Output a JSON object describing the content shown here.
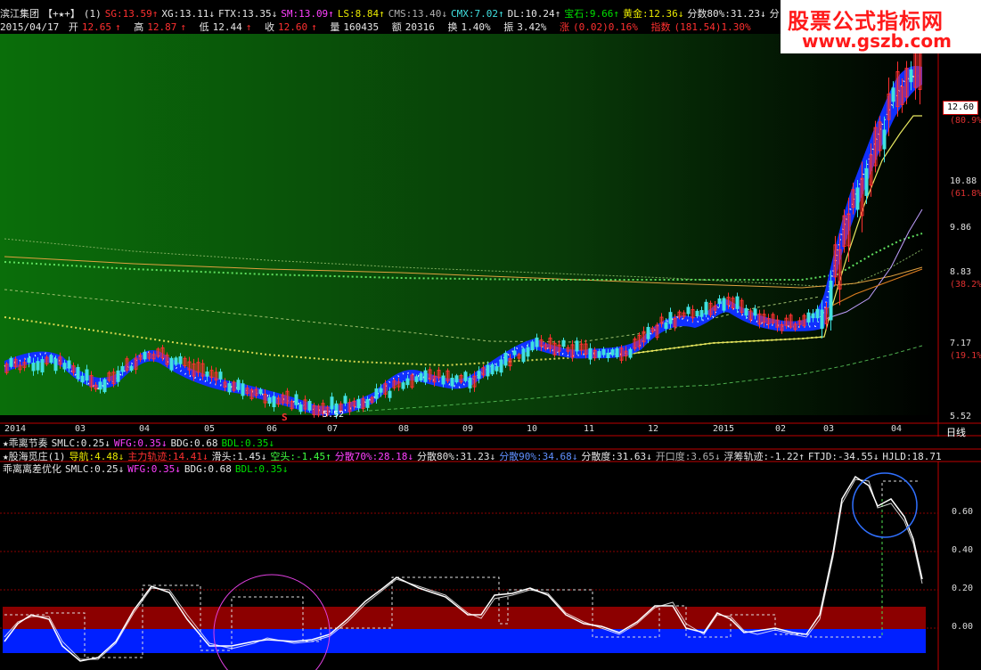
{
  "header": {
    "stock_name": "滨江集团",
    "stars": "【+★+】",
    "count": "(1)",
    "indicators": [
      {
        "label": "SG:13.59",
        "arrow": "↑",
        "color": "red"
      },
      {
        "label": "XG:13.11",
        "arrow": "↓",
        "color": "white"
      },
      {
        "label": "FTX:13.35",
        "arrow": "↓",
        "color": "white"
      },
      {
        "label": "SM:13.09",
        "arrow": "↑",
        "color": "magenta"
      },
      {
        "label": "LS:8.84",
        "arrow": "↑",
        "color": "yellow"
      },
      {
        "label": "CMS:13.40",
        "arrow": "↓",
        "color": "gray"
      },
      {
        "label": "CMX:7.02",
        "arrow": "↑",
        "color": "cyan"
      },
      {
        "label": "DL:10.24",
        "arrow": "↑",
        "color": "white"
      },
      {
        "label": "宝石:9.66",
        "arrow": "↑",
        "color": "green"
      },
      {
        "label": "黄金:12.36",
        "arrow": "↓",
        "color": "yellow"
      },
      {
        "label": "分数80%:31.23",
        "arrow": "↓",
        "color": "white"
      },
      {
        "label": "分散度",
        "arrow": "",
        "color": "white"
      }
    ]
  },
  "quote": {
    "date": "2015/04/17",
    "open_label": "开",
    "open": "12.65",
    "high_label": "高",
    "high": "12.87",
    "low_label": "低",
    "low": "12.44",
    "close_label": "收",
    "close": "12.60",
    "volume_label": "量",
    "volume": "160435",
    "amount_label": "额",
    "amount": "20316",
    "turnover_label": "换",
    "turnover": "1.40%",
    "amplitude_label": "振",
    "amplitude": "3.42%",
    "change_label": "涨",
    "change": "(0.02)0.16%",
    "index_label": "指数",
    "index": "(181.54)1.30%"
  },
  "watermark": {
    "line1": "股票公式指标网",
    "line2": "www.gszb.com"
  },
  "price_axis": {
    "current_price": "12.60",
    "ticks": [
      {
        "value": "(80.9%)",
        "type": "pct"
      },
      {
        "value": "10.88",
        "type": "price"
      },
      {
        "value": "(61.8%)",
        "type": "pct"
      },
      {
        "value": "9.86",
        "type": "price"
      },
      {
        "value": "8.83",
        "type": "price"
      },
      {
        "value": "(38.2%)",
        "type": "pct"
      },
      {
        "value": "7.17",
        "type": "price"
      },
      {
        "value": "(19.1%)",
        "type": "pct"
      },
      {
        "value": "5.52",
        "type": "price"
      }
    ],
    "low_marker": "5.52",
    "s_marker": "S"
  },
  "time_axis": {
    "labels": [
      "2014",
      "03",
      "04",
      "05",
      "06",
      "07",
      "08",
      "09",
      "10",
      "11",
      "12",
      "2015",
      "02",
      "03",
      "04"
    ],
    "period_label": "日线"
  },
  "sub_panel_1": {
    "title": "★乖离节奏",
    "items": [
      {
        "label": "SMLC:0.25",
        "arrow": "↓",
        "color": "white"
      },
      {
        "label": "WFG:0.35",
        "arrow": "↓",
        "color": "magenta"
      },
      {
        "label": "BDG:0.68",
        "arrow": "",
        "color": "white"
      },
      {
        "label": "BDL:0.35",
        "arrow": "↓",
        "color": "green"
      }
    ]
  },
  "sub_panel_2": {
    "title": "★股海觅庄(1)",
    "items": [
      {
        "label": "导航:4.48",
        "arrow": "↓",
        "color": "yellow"
      },
      {
        "label": "主力轨迹:14.41",
        "arrow": "↓",
        "color": "red"
      },
      {
        "label": "滑头:1.45",
        "arrow": "↓",
        "color": "white"
      },
      {
        "label": "空头:-1.45",
        "arrow": "↑",
        "color": "lightgreen"
      },
      {
        "label": "分散70%:28.18",
        "arrow": "↓",
        "color": "magenta"
      },
      {
        "label": "分散80%:31.23",
        "arrow": "↓",
        "color": "white"
      },
      {
        "label": "分散90%:34.68",
        "arrow": "↓",
        "color": "blue"
      },
      {
        "label": "分散度:31.63",
        "arrow": "↓",
        "color": "white"
      },
      {
        "label": "开口度:3.65",
        "arrow": "↓",
        "color": "gray"
      },
      {
        "label": "浮筹轨迹:-1.22",
        "arrow": "↑",
        "color": "white"
      },
      {
        "label": "FTJD:-34.55",
        "arrow": "↓",
        "color": "white"
      },
      {
        "label": "HJLD:18.71",
        "arrow": "",
        "color": "white"
      }
    ]
  },
  "sub_panel_3": {
    "title": "乖离离差优化",
    "items": [
      {
        "label": "SMLC:0.25",
        "arrow": "↓",
        "color": "white"
      },
      {
        "label": "WFG:0.35",
        "arrow": "↓",
        "color": "magenta"
      },
      {
        "label": "BDG:0.68",
        "arrow": "",
        "color": "white"
      },
      {
        "label": "BDL:0.35",
        "arrow": "↓",
        "color": "green"
      }
    ],
    "axis_ticks": [
      "0.60",
      "0.40",
      "0.20",
      "0.00"
    ]
  },
  "colors": {
    "candle_up": "#ff3030",
    "candle_down": "#40e0e0",
    "band": "#1030ff",
    "band_dots": "#ffffff",
    "lower_red": "#8c0000",
    "lower_blue": "#0020ff",
    "grid": "#8c0000"
  },
  "chart_data": {
    "type": "line",
    "title": "",
    "price_series": {
      "name": "",
      "months": [
        "2014",
        "03",
        "04",
        "05",
        "06",
        "07",
        "08",
        "09",
        "10",
        "11",
        "12",
        "2015",
        "02",
        "03",
        "04"
      ],
      "close_approx": [
        6.7,
        6.45,
        6.7,
        6.4,
        6.0,
        5.6,
        6.4,
        6.5,
        6.9,
        6.8,
        7.3,
        7.6,
        7.3,
        9.2,
        12.6
      ]
    },
    "oscillator": {
      "ylim": [
        0.0,
        0.7
      ],
      "ticks": [
        0.0,
        0.2,
        0.4,
        0.6
      ]
    }
  }
}
